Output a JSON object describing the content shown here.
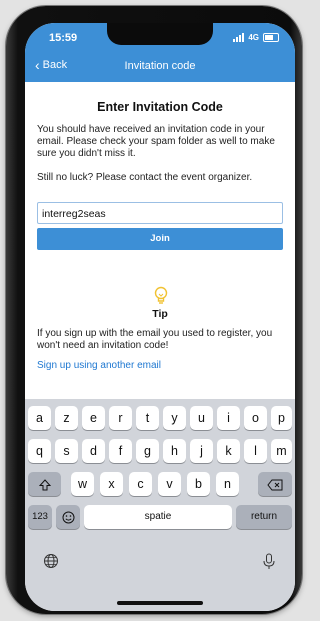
{
  "status": {
    "time": "15:59",
    "network": "4G"
  },
  "nav": {
    "back_label": "Back",
    "title": "Invitation code"
  },
  "page": {
    "heading": "Enter Invitation Code",
    "intro": "You should have received an invitation code in your email. Please check your spam folder as well to make sure you didn't miss it.",
    "contact": "Still no luck? Please contact the event organizer.",
    "code_value": "interreg2seas",
    "join_label": "Join"
  },
  "tip": {
    "label": "Tip",
    "text": "If you sign up with the email you used to register, you won't need an invitation code!",
    "link": "Sign up using another email"
  },
  "keyboard": {
    "row1": [
      "a",
      "z",
      "e",
      "r",
      "t",
      "y",
      "u",
      "i",
      "o",
      "p"
    ],
    "row2": [
      "q",
      "s",
      "d",
      "f",
      "g",
      "h",
      "j",
      "k",
      "l",
      "m"
    ],
    "row3": [
      "w",
      "x",
      "c",
      "v",
      "b",
      "n"
    ],
    "numbers_label": "123",
    "space_label": "spatie",
    "return_label": "return"
  },
  "colors": {
    "accent": "#3d8fd6",
    "link": "#1f78d1",
    "keyboard_bg": "#d1d4da"
  }
}
